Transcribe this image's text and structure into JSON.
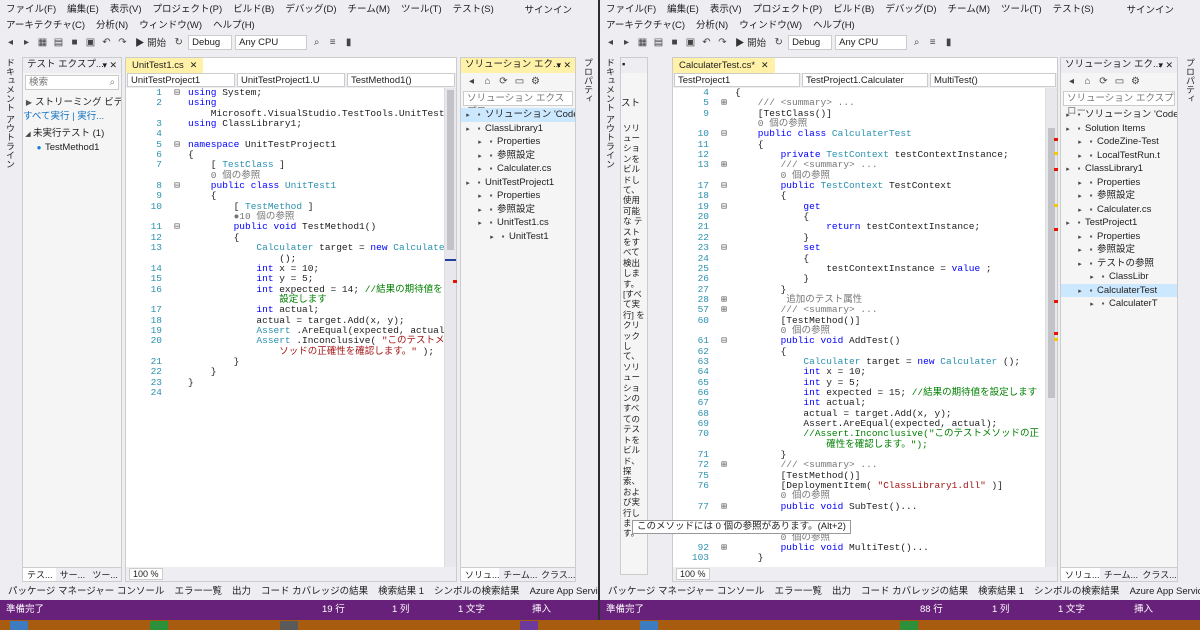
{
  "left": {
    "menu_row1": [
      "ファイル(F)",
      "編集(E)",
      "表示(V)",
      "プロジェクト(P)",
      "ビルド(B)",
      "デバッグ(D)",
      "チーム(M)",
      "ツール(T)",
      "テスト(S)"
    ],
    "menu_row2": [
      "アーキテクチャ(C)",
      "分析(N)",
      "ウィンドウ(W)",
      "ヘルプ(H)"
    ],
    "signin": "サインイン",
    "toolbar": {
      "start": "▶ 開始",
      "config": "Debug",
      "platform": "Any CPU"
    },
    "vtab_label": "ドキュメント アウトライン",
    "vtab_right_label": "プロパティ",
    "test_explorer": {
      "title": "テスト エクスプ...",
      "search_placeholder": "検索",
      "streaming": "ストリーミング ビデ",
      "run_all": "すべて実行",
      "run": "実行...",
      "group": "未実行テスト (1)",
      "item": "TestMethod1",
      "tabs": [
        "テス...",
        "サー...",
        "ツー..."
      ]
    },
    "editor": {
      "tab": "UnitTest1.cs",
      "nav": [
        "UnitTestProject1",
        "UnitTestProject1.U",
        "TestMethod1()"
      ],
      "zoom": "100 %"
    },
    "solution": {
      "title": "ソリューション エク...",
      "search": "ソリューション エクスプロー",
      "items": [
        {
          "label": "ソリューション 'CodeZin",
          "level": 0,
          "selected": true
        },
        {
          "label": "ClassLibrary1",
          "level": 0
        },
        {
          "label": "Properties",
          "level": 1
        },
        {
          "label": "参照設定",
          "level": 1
        },
        {
          "label": "Calculater.cs",
          "level": 1
        },
        {
          "label": "UnitTestProject1",
          "level": 0
        },
        {
          "label": "Properties",
          "level": 1
        },
        {
          "label": "参照設定",
          "level": 1
        },
        {
          "label": "UnitTest1.cs",
          "level": 1
        },
        {
          "label": "UnitTest1",
          "level": 2
        }
      ],
      "tabs": [
        "ソリュ...",
        "チーム...",
        "クラス..."
      ]
    },
    "output_tabs": [
      "パッケージ マネージャー コンソール",
      "エラー一覧",
      "出力",
      "コード カバレッジの結果",
      "検索結果 1",
      "シンボルの検索結果",
      "Azure App Service Activity"
    ],
    "status": {
      "ready": "準備完了",
      "line": "19 行",
      "col": "1 列",
      "ch": "1 文字",
      "ins": "挿入"
    }
  },
  "right": {
    "menu_row1": [
      "ファイル(F)",
      "編集(E)",
      "表示(V)",
      "プロジェクト(P)",
      "ビルド(B)",
      "デバッグ(D)",
      "チーム(M)",
      "ツール(T)",
      "テスト(S)"
    ],
    "menu_row2": [
      "アーキテクチャ(C)",
      "分析(N)",
      "ウィンドウ(W)",
      "ヘルプ(H)"
    ],
    "signin": "サインイン",
    "toolbar": {
      "start": "▶ 開始",
      "config": "Debug",
      "platform": "Any CPU"
    },
    "vtab_label": "ドキュメント アウトライン",
    "vtab_right_label": "プロパティ",
    "test_panel": {
      "streaming": "スト",
      "text": "ソリューションをビルドし て、使用可能な テストをすべて検出します。[すべて実行] をクリックして、ソリューションのすべてのテストをビルド、探索、および実行します。",
      "tabs": [
        "テス...",
        "",
        "",
        ""
      ]
    },
    "editor": {
      "tab": "CalculaterTest.cs*",
      "nav": [
        "TestProject1",
        "TestProject1.Calculater",
        "MultiTest()"
      ],
      "zoom": "100 %"
    },
    "solution": {
      "title": "ソリューション エク...",
      "search": "ソリューション エクスプロー",
      "items": [
        {
          "label": "ソリューション 'CodeZine",
          "level": 0
        },
        {
          "label": "Solution Items",
          "level": 0
        },
        {
          "label": "CodeZine-Test",
          "level": 1
        },
        {
          "label": "LocalTestRun.t",
          "level": 1
        },
        {
          "label": "ClassLibrary1",
          "level": 0
        },
        {
          "label": "Properties",
          "level": 1
        },
        {
          "label": "参照設定",
          "level": 1
        },
        {
          "label": "Calculater.cs",
          "level": 1
        },
        {
          "label": "TestProject1",
          "level": 0
        },
        {
          "label": "Properties",
          "level": 1
        },
        {
          "label": "参照設定",
          "level": 1
        },
        {
          "label": "テストの参照",
          "level": 1
        },
        {
          "label": "ClassLibr",
          "level": 2
        },
        {
          "label": "CalculaterTest",
          "level": 1,
          "selected": true
        },
        {
          "label": "CalculaterT",
          "level": 2
        }
      ],
      "tabs": [
        "ソリュ...",
        "チーム...",
        "クラス..."
      ]
    },
    "output_tabs": [
      "パッケージ マネージャー コンソール",
      "エラー一覧",
      "出力",
      "コード カバレッジの結果",
      "検索結果 1",
      "シンボルの検索結果",
      "Azure App Service Activity"
    ],
    "status": {
      "ready": "準備完了",
      "line": "88 行",
      "col": "1 列",
      "ch": "1 文字",
      "ins": "挿入"
    },
    "tooltip": "このメソッドには 0 個の参照があります。(Alt+2)"
  },
  "code_left": [
    {
      "n": "1",
      "g": "⊟",
      "t": [
        [
          "kw",
          "using"
        ],
        [
          "",
          "System;"
        ]
      ]
    },
    {
      "n": "2",
      "g": "",
      "t": [
        [
          "kw",
          "using"
        ]
      ]
    },
    {
      "n": "",
      "g": "",
      "t": [
        [
          "",
          "    Microsoft.VisualStudio.TestTools.UnitTesting;"
        ]
      ]
    },
    {
      "n": "3",
      "g": "",
      "t": [
        [
          "kw",
          "using"
        ],
        [
          "",
          "ClassLibrary1;"
        ]
      ]
    },
    {
      "n": "4",
      "g": "",
      "t": []
    },
    {
      "n": "5",
      "g": "⊟",
      "t": [
        [
          "kw",
          "namespace"
        ],
        [
          "",
          "UnitTestProject1"
        ]
      ]
    },
    {
      "n": "6",
      "g": "",
      "t": [
        [
          "",
          "{"
        ]
      ]
    },
    {
      "n": "7",
      "g": "",
      "t": [
        [
          "",
          "    ["
        ],
        [
          "ty",
          "TestClass"
        ],
        [
          "",
          "]"
        ]
      ]
    },
    {
      "n": "",
      "g": "",
      "t": [
        [
          "gr",
          "    0 個の参照"
        ]
      ]
    },
    {
      "n": "8",
      "g": "⊟",
      "t": [
        [
          "kw",
          "    public class"
        ],
        [
          "ty",
          "UnitTest1"
        ]
      ]
    },
    {
      "n": "9",
      "g": "",
      "t": [
        [
          "",
          "    {"
        ]
      ]
    },
    {
      "n": "10",
      "g": "",
      "t": [
        [
          "",
          "        ["
        ],
        [
          "ty",
          "TestMethod"
        ],
        [
          "",
          "]"
        ]
      ]
    },
    {
      "n": "",
      "g": "",
      "t": [
        [
          "gr",
          "        ●10 個の参照"
        ]
      ]
    },
    {
      "n": "11",
      "g": "⊟",
      "t": [
        [
          "kw",
          "        public void"
        ],
        [
          "",
          "TestMethod1()"
        ]
      ]
    },
    {
      "n": "12",
      "g": "",
      "t": [
        [
          "",
          "        {"
        ]
      ]
    },
    {
      "n": "13",
      "g": "",
      "t": [
        [
          "ty",
          "            Calculater"
        ],
        [
          "",
          "target ="
        ],
        [
          "kw",
          "new"
        ],
        [
          "ty",
          "Calculater"
        ]
      ]
    },
    {
      "n": "",
      "g": "",
      "t": [
        [
          "",
          "                ();"
        ]
      ]
    },
    {
      "n": "14",
      "g": "",
      "t": [
        [
          "kw",
          "            int"
        ],
        [
          "",
          "x = 10;"
        ]
      ]
    },
    {
      "n": "15",
      "g": "",
      "t": [
        [
          "kw",
          "            int"
        ],
        [
          "",
          "y = 5;"
        ]
      ]
    },
    {
      "n": "16",
      "g": "",
      "t": [
        [
          "kw",
          "            int"
        ],
        [
          "",
          "expected = 14;"
        ],
        [
          "cm",
          "//結果の期待値を"
        ]
      ]
    },
    {
      "n": "",
      "g": "",
      "t": [
        [
          "cm",
          "                設定します"
        ]
      ]
    },
    {
      "n": "17",
      "g": "",
      "t": [
        [
          "kw",
          "            int"
        ],
        [
          "",
          "actual;"
        ]
      ]
    },
    {
      "n": "18",
      "g": "",
      "t": [
        [
          "",
          "            actual = target.Add(x, y);"
        ]
      ]
    },
    {
      "n": "19",
      "g": "",
      "t": [
        [
          "ty",
          "            Assert"
        ],
        [
          "",
          ".AreEqual(expected, actual);"
        ]
      ]
    },
    {
      "n": "20",
      "g": "",
      "t": [
        [
          "ty",
          "            Assert"
        ],
        [
          "",
          ".Inconclusive("
        ],
        [
          "st",
          "\"このテストメ"
        ]
      ]
    },
    {
      "n": "",
      "g": "",
      "t": [
        [
          "st",
          "                ソッドの正確性を確認します。\""
        ],
        [
          "",
          ");"
        ]
      ]
    },
    {
      "n": "21",
      "g": "",
      "t": [
        [
          "",
          "        }"
        ]
      ]
    },
    {
      "n": "22",
      "g": "",
      "t": [
        [
          "",
          "    }"
        ]
      ]
    },
    {
      "n": "23",
      "g": "",
      "t": [
        [
          "",
          "}"
        ]
      ]
    },
    {
      "n": "24",
      "g": "",
      "t": []
    }
  ],
  "code_right": [
    {
      "n": "4",
      "g": "",
      "t": [
        [
          "",
          "{"
        ]
      ]
    },
    {
      "n": "5",
      "g": "⊞",
      "t": [
        [
          "gr",
          "    /// <summary> ..."
        ]
      ]
    },
    {
      "n": "9",
      "g": "",
      "t": [
        [
          "",
          "    [TestClass()]"
        ]
      ]
    },
    {
      "n": "",
      "g": "",
      "t": [
        [
          "gr",
          "    0 個の参照"
        ]
      ]
    },
    {
      "n": "10",
      "g": "⊟",
      "t": [
        [
          "kw",
          "    public class"
        ],
        [
          "ty",
          "CalculaterTest"
        ]
      ]
    },
    {
      "n": "11",
      "g": "",
      "t": [
        [
          "",
          "    {"
        ]
      ]
    },
    {
      "n": "12",
      "g": "",
      "t": [
        [
          "kw",
          "        private"
        ],
        [
          "ty",
          "TestContext"
        ],
        [
          "",
          "testContextInstance;"
        ]
      ]
    },
    {
      "n": "13",
      "g": "⊞",
      "t": [
        [
          "gr",
          "        /// <summary> ..."
        ]
      ]
    },
    {
      "n": "",
      "g": "",
      "t": [
        [
          "gr",
          "        0 個の参照"
        ]
      ]
    },
    {
      "n": "17",
      "g": "⊟",
      "t": [
        [
          "kw",
          "        public"
        ],
        [
          "ty",
          "TestContext"
        ],
        [
          "",
          "TestContext"
        ]
      ]
    },
    {
      "n": "18",
      "g": "",
      "t": [
        [
          "",
          "        {"
        ]
      ]
    },
    {
      "n": "19",
      "g": "⊟",
      "t": [
        [
          "kw",
          "            get"
        ]
      ]
    },
    {
      "n": "20",
      "g": "",
      "t": [
        [
          "",
          "            {"
        ]
      ]
    },
    {
      "n": "21",
      "g": "",
      "t": [
        [
          "kw",
          "                return"
        ],
        [
          "",
          "testContextInstance;"
        ]
      ]
    },
    {
      "n": "22",
      "g": "",
      "t": [
        [
          "",
          "            }"
        ]
      ]
    },
    {
      "n": "23",
      "g": "⊟",
      "t": [
        [
          "kw",
          "            set"
        ]
      ]
    },
    {
      "n": "24",
      "g": "",
      "t": [
        [
          "",
          "            {"
        ]
      ]
    },
    {
      "n": "25",
      "g": "",
      "t": [
        [
          "",
          "                testContextInstance ="
        ],
        [
          "kw",
          "value"
        ],
        [
          "",
          ";"
        ]
      ]
    },
    {
      "n": "26",
      "g": "",
      "t": [
        [
          "",
          "            }"
        ]
      ]
    },
    {
      "n": "27",
      "g": "",
      "t": [
        [
          "",
          "        }"
        ]
      ]
    },
    {
      "n": "28",
      "g": "⊞",
      "t": [
        [
          "",
          "        "
        ],
        [
          "gr",
          "追加のテスト属性"
        ]
      ]
    },
    {
      "n": "57",
      "g": "⊞",
      "t": [
        [
          "gr",
          "        /// <summary> ..."
        ]
      ]
    },
    {
      "n": "60",
      "g": "",
      "t": [
        [
          "",
          "        [TestMethod()]"
        ]
      ]
    },
    {
      "n": "",
      "g": "",
      "t": [
        [
          "gr",
          "        0 個の参照"
        ]
      ]
    },
    {
      "n": "61",
      "g": "⊟",
      "t": [
        [
          "kw",
          "        public void"
        ],
        [
          "",
          "AddTest()"
        ]
      ]
    },
    {
      "n": "62",
      "g": "",
      "t": [
        [
          "",
          "        {"
        ]
      ]
    },
    {
      "n": "63",
      "g": "",
      "t": [
        [
          "ty",
          "            Calculater"
        ],
        [
          "",
          "target ="
        ],
        [
          "kw",
          "new"
        ],
        [
          "ty",
          "Calculater"
        ],
        [
          "",
          "();"
        ]
      ]
    },
    {
      "n": "64",
      "g": "",
      "t": [
        [
          "kw",
          "            int"
        ],
        [
          "",
          "x = 10;"
        ]
      ]
    },
    {
      "n": "65",
      "g": "",
      "t": [
        [
          "kw",
          "            int"
        ],
        [
          "",
          "y = 5;"
        ]
      ]
    },
    {
      "n": "66",
      "g": "",
      "t": [
        [
          "kw",
          "            int"
        ],
        [
          "",
          "expected = 15;"
        ],
        [
          "cm",
          "//結果の期待値を設定します"
        ]
      ]
    },
    {
      "n": "67",
      "g": "",
      "t": [
        [
          "kw",
          "            int"
        ],
        [
          "",
          "actual;"
        ]
      ]
    },
    {
      "n": "68",
      "g": "",
      "t": [
        [
          "",
          "            actual = target.Add(x, y);"
        ]
      ]
    },
    {
      "n": "69",
      "g": "",
      "t": [
        [
          "",
          "            Assert.AreEqual(expected, actual);"
        ]
      ]
    },
    {
      "n": "70",
      "g": "",
      "t": [
        [
          "cm",
          "            //Assert.Inconclusive(\"このテストメソッドの正"
        ]
      ]
    },
    {
      "n": "",
      "g": "",
      "t": [
        [
          "cm",
          "                確性を確認します。\");"
        ]
      ]
    },
    {
      "n": "71",
      "g": "",
      "t": [
        [
          "",
          "        }"
        ]
      ]
    },
    {
      "n": "72",
      "g": "⊞",
      "t": [
        [
          "gr",
          "        /// <summary> ..."
        ]
      ]
    },
    {
      "n": "75",
      "g": "",
      "t": [
        [
          "",
          "        [TestMethod()]"
        ]
      ]
    },
    {
      "n": "76",
      "g": "",
      "t": [
        [
          "",
          "        [DeploymentItem("
        ],
        [
          "st",
          "\"ClassLibrary1.dll\""
        ],
        [
          "",
          ")]"
        ]
      ]
    },
    {
      "n": "",
      "g": "",
      "t": [
        [
          "gr",
          "        0 個の参照"
        ]
      ]
    },
    {
      "n": "77",
      "g": "⊞",
      "t": [
        [
          "kw",
          "        public void"
        ],
        [
          "",
          "SubTest()..."
        ]
      ]
    },
    {
      "n": "",
      "g": "",
      "t": []
    },
    {
      "n": "",
      "g": "",
      "t": [
        [
          "",
          "        ()]"
        ]
      ]
    },
    {
      "n": "",
      "g": "",
      "t": [
        [
          "gr",
          "        0 個の参照"
        ]
      ]
    },
    {
      "n": "92",
      "g": "⊞",
      "t": [
        [
          "kw",
          "        public void"
        ],
        [
          "",
          "MultiTest()..."
        ]
      ]
    },
    {
      "n": "103",
      "g": "",
      "t": [
        [
          "",
          "    }"
        ]
      ]
    }
  ]
}
